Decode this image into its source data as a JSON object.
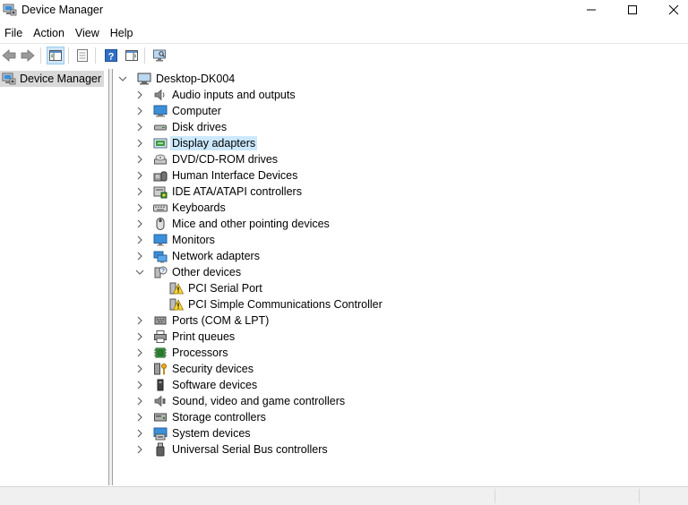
{
  "window": {
    "title": "Device Manager"
  },
  "menu": [
    "File",
    "Action",
    "View",
    "Help"
  ],
  "left_pane": {
    "item": "Device Manager"
  },
  "tree": {
    "root": "Desktop-DK004",
    "categories": [
      {
        "label": "Audio inputs and outputs",
        "icon": "speaker-icon"
      },
      {
        "label": "Computer",
        "icon": "computer-icon"
      },
      {
        "label": "Disk drives",
        "icon": "disk-drive-icon"
      },
      {
        "label": "Display adapters",
        "icon": "display-adapter-icon",
        "selected": true
      },
      {
        "label": "DVD/CD-ROM drives",
        "icon": "dvd-drive-icon"
      },
      {
        "label": "Human Interface Devices",
        "icon": "hid-icon"
      },
      {
        "label": "IDE ATA/ATAPI controllers",
        "icon": "ide-controller-icon"
      },
      {
        "label": "Keyboards",
        "icon": "keyboard-icon"
      },
      {
        "label": "Mice and other pointing devices",
        "icon": "mouse-icon"
      },
      {
        "label": "Monitors",
        "icon": "monitor-icon"
      },
      {
        "label": "Network adapters",
        "icon": "network-adapter-icon"
      },
      {
        "label": "Other devices",
        "icon": "unknown-device-icon",
        "expanded": true,
        "children": [
          {
            "label": "PCI Serial Port",
            "icon": "warning-device-icon"
          },
          {
            "label": "PCI Simple Communications Controller",
            "icon": "warning-device-icon"
          }
        ]
      },
      {
        "label": "Ports (COM & LPT)",
        "icon": "port-icon"
      },
      {
        "label": "Print queues",
        "icon": "printer-icon"
      },
      {
        "label": "Processors",
        "icon": "processor-icon"
      },
      {
        "label": "Security devices",
        "icon": "security-device-icon"
      },
      {
        "label": "Software devices",
        "icon": "software-device-icon"
      },
      {
        "label": "Sound, video and game controllers",
        "icon": "sound-controller-icon"
      },
      {
        "label": "Storage controllers",
        "icon": "storage-controller-icon"
      },
      {
        "label": "System devices",
        "icon": "system-device-icon"
      },
      {
        "label": "Universal Serial Bus controllers",
        "icon": "usb-icon"
      }
    ]
  },
  "toolbar": {
    "buttons": [
      "back-icon",
      "forward-icon",
      "show-hide-console-tree-icon",
      "properties-icon",
      "help-icon",
      "action-pane-icon",
      "scan-hardware-icon"
    ]
  },
  "colors": {
    "selection": "#cce8ff",
    "toolbar_pressed": "#cde6f7",
    "status_bar": "#f0f0f0"
  }
}
